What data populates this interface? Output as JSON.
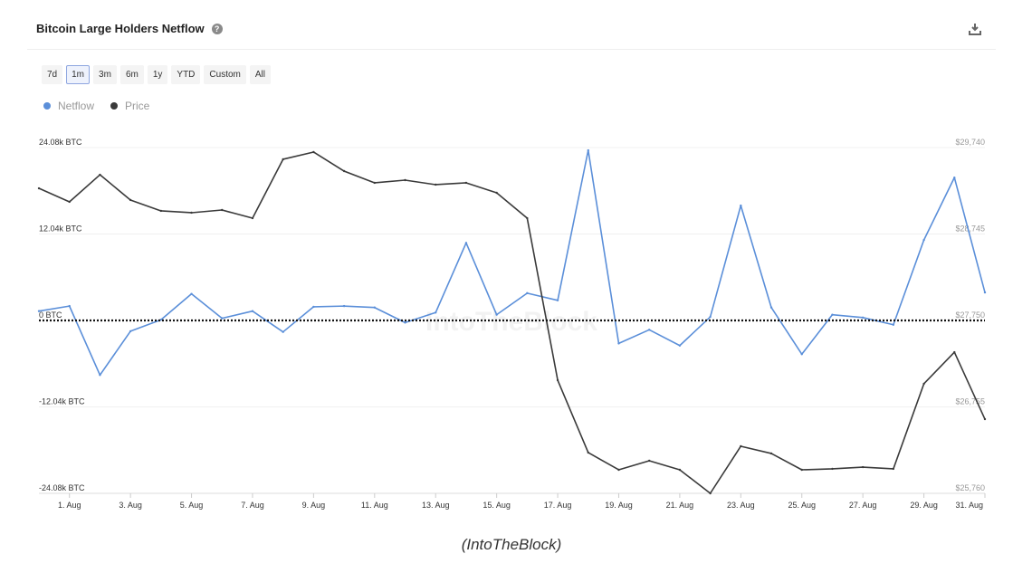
{
  "header": {
    "title": "Bitcoin Large Holders Netflow",
    "help_icon": "question-circle-icon",
    "download_icon": "download-icon"
  },
  "ranges": [
    {
      "label": "7d"
    },
    {
      "label": "1m",
      "active": true
    },
    {
      "label": "3m"
    },
    {
      "label": "6m"
    },
    {
      "label": "1y"
    },
    {
      "label": "YTD"
    },
    {
      "label": "Custom"
    },
    {
      "label": "All"
    }
  ],
  "caption": "(IntoTheBlock)",
  "watermark": "IntoTheBlock",
  "chart_data": {
    "type": "line",
    "title": "Bitcoin Large Holders Netflow",
    "legend_placement": "top-left",
    "grid": true,
    "x": [
      "31 Jul",
      "1 Aug",
      "2 Aug",
      "3 Aug",
      "4 Aug",
      "5 Aug",
      "6 Aug",
      "7 Aug",
      "8 Aug",
      "9 Aug",
      "10 Aug",
      "11 Aug",
      "12 Aug",
      "13 Aug",
      "14 Aug",
      "15 Aug",
      "16 Aug",
      "17 Aug",
      "18 Aug",
      "19 Aug",
      "20 Aug",
      "21 Aug",
      "22 Aug",
      "23 Aug",
      "24 Aug",
      "25 Aug",
      "26 Aug",
      "27 Aug",
      "28 Aug",
      "29 Aug",
      "30 Aug",
      "31 Aug"
    ],
    "x_tick_labels": [
      "1. Aug",
      "3. Aug",
      "5. Aug",
      "7. Aug",
      "9. Aug",
      "11. Aug",
      "13. Aug",
      "15. Aug",
      "17. Aug",
      "19. Aug",
      "21. Aug",
      "23. Aug",
      "25. Aug",
      "27. Aug",
      "29. Aug",
      "31. Aug"
    ],
    "left_axis": {
      "ticks": [
        "24.08k BTC",
        "12.04k BTC",
        "0 BTC",
        "-12.04k BTC",
        "-24.08k BTC"
      ],
      "range": [
        -24.08,
        24.08
      ],
      "unit": "k BTC"
    },
    "right_axis": {
      "ticks": [
        "$29,740",
        "$28,745",
        "$27,750",
        "$26,755",
        "$25,760"
      ],
      "range": [
        25760,
        29740
      ],
      "unit": "USD"
    },
    "series": [
      {
        "name": "Netflow",
        "axis": "left",
        "color": "#5b8fd9",
        "values": [
          1.3,
          2.0,
          -7.6,
          -1.5,
          0.1,
          3.7,
          0.3,
          1.3,
          -1.6,
          1.9,
          2.0,
          1.8,
          -0.3,
          1.1,
          10.8,
          0.8,
          3.8,
          2.8,
          23.7,
          -3.2,
          -1.3,
          -3.5,
          0.5,
          16.0,
          1.8,
          -4.7,
          0.8,
          0.4,
          -0.6,
          11.2,
          19.9,
          3.9
        ]
      },
      {
        "name": "Price",
        "axis": "right",
        "color": "#3a3a3a",
        "values": [
          29271,
          29115,
          29427,
          29136,
          29011,
          28990,
          29021,
          28927,
          29605,
          29688,
          29469,
          29334,
          29365,
          29313,
          29334,
          29219,
          28927,
          27062,
          26229,
          26031,
          26135,
          26031,
          25760,
          26302,
          26219,
          26031,
          26042,
          26062,
          26042,
          27021,
          27385,
          26614
        ]
      }
    ]
  }
}
